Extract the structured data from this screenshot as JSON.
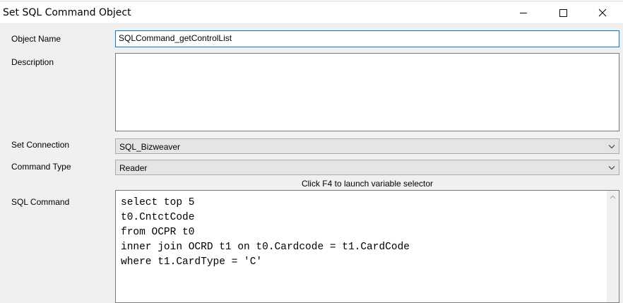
{
  "window": {
    "title": "Set SQL Command Object",
    "minimize_glyph": "—",
    "colors": {
      "window_bg": "#f0f0f0",
      "focus_border": "#0078d7",
      "combo_bg": "#e5e5e5"
    }
  },
  "fields": {
    "object_name": {
      "label": "Object Name",
      "value": "SQLCommand_getControlList"
    },
    "description": {
      "label": "Description",
      "value": ""
    },
    "connection": {
      "label": "Set Connection",
      "value": "SQL_Bizweaver"
    },
    "command_type": {
      "label": "Command Type",
      "value": "Reader"
    },
    "sql_command": {
      "label": "SQL Command",
      "hint": "Click F4 to launch variable selector",
      "lines": [
        "select top 5",
        "t0.CntctCode",
        "from OCPR t0",
        "inner join OCRD t1 on t0.Cardcode = t1.CardCode",
        "where t1.CardType = 'C'"
      ]
    }
  },
  "icons": {
    "minimize": "minimize-icon",
    "maximize": "maximize-icon",
    "close": "close-icon",
    "dropdown": "chevron-down-icon",
    "scroll_up": "scroll-up-arrow-icon"
  }
}
